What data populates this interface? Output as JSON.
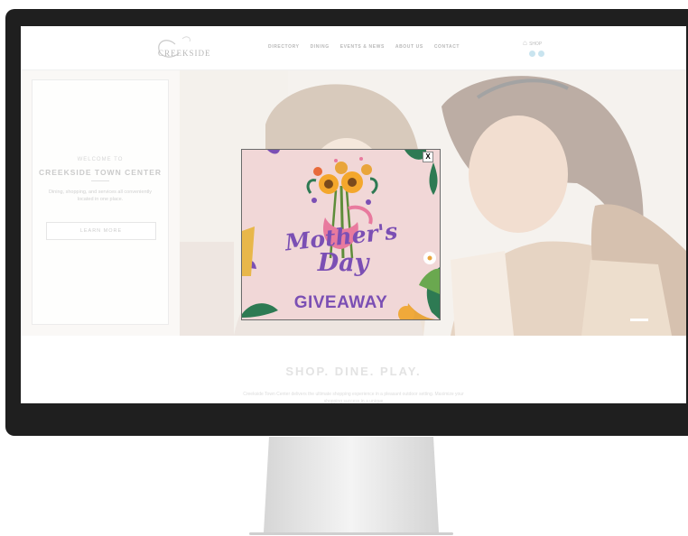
{
  "header": {
    "logo_text": "CREEKSIDE",
    "nav": [
      "DIRECTORY",
      "DINING",
      "EVENTS & NEWS",
      "ABOUT US",
      "CONTACT"
    ],
    "shop_label": "SHOP"
  },
  "hero": {
    "welcome_small": "WELCOME TO",
    "welcome_title": "CREEKSIDE TOWN CENTER",
    "welcome_desc": "Dining, shopping, and services all conveniently located in one place.",
    "learn_more": "LEARN MORE"
  },
  "section": {
    "tagline": "SHOP. DINE. PLAY.",
    "description": "Creekside Town Center delivers the ultimate shopping experience in a pleasant outdoor setting. Maximize your shopping success in a unique"
  },
  "modal": {
    "close": "X",
    "line1": "Mother's",
    "line2": "Day",
    "line3": "GIVEAWAY"
  },
  "colors": {
    "modal_bg": "#f1d7d7",
    "accent_purple": "#7b4fb4",
    "monitor_bezel": "#1f1f1f"
  }
}
